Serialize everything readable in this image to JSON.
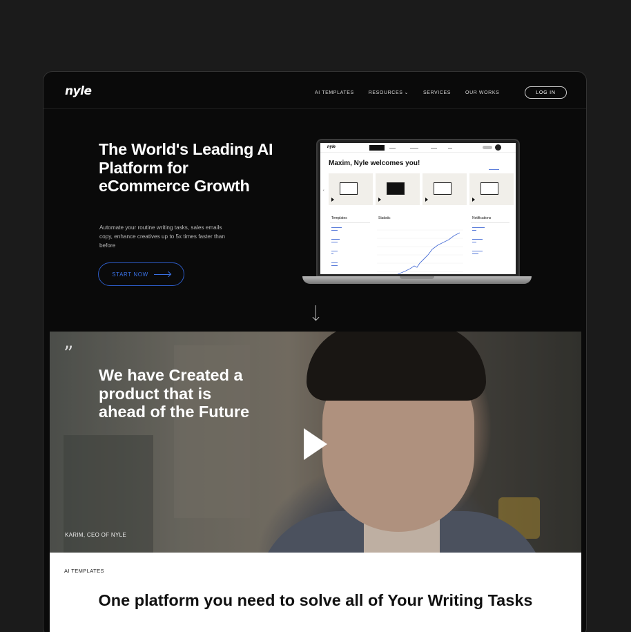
{
  "nav": {
    "logo": "nyle",
    "links": [
      "AI TEMPLATES",
      "RESOURCES",
      "SERVICES",
      "OUR WORKS"
    ],
    "resources_chevron": "chevron-down-icon",
    "login": "LOG IN"
  },
  "hero": {
    "title": "The World's Leading AI Platform for eCommerce Growth",
    "subtitle": "Automate your routine writing tasks, sales emails copy, enhance creatives up to 5x times faster than before",
    "cta": "START NOW"
  },
  "dashboard": {
    "logo": "nyle",
    "welcome": "Maxim, Nyle welcomes you!",
    "columns": [
      "Templates",
      "Statistic",
      "Notifications"
    ]
  },
  "video": {
    "title": "We have Created a product that is ahead of the Future",
    "caption": "KARIM, CEO OF NYLE"
  },
  "section": {
    "label": "AI TEMPLATES",
    "title": "One platform you need to solve all of Your Writing Tasks"
  },
  "colors": {
    "accent": "#3a72e6",
    "background": "#0a0a0a",
    "page": "#1b1b1b"
  }
}
